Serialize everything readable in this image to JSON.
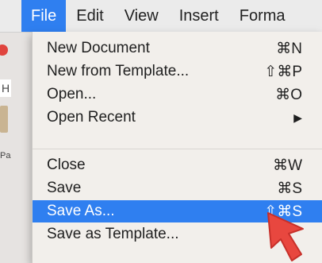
{
  "menubar": {
    "items": [
      {
        "label": "File"
      },
      {
        "label": "Edit"
      },
      {
        "label": "View"
      },
      {
        "label": "Insert"
      },
      {
        "label": "Forma"
      }
    ]
  },
  "background": {
    "h_label": "H",
    "pa_label": "Pa"
  },
  "file_menu": {
    "items": [
      {
        "label": "New Document",
        "shortcut": "⌘N"
      },
      {
        "label": "New from Template...",
        "shortcut": "⇧⌘P"
      },
      {
        "label": "Open...",
        "shortcut": "⌘O"
      },
      {
        "label": "Open Recent",
        "shortcut": "▶"
      },
      {
        "label": "Close",
        "shortcut": "⌘W"
      },
      {
        "label": "Save",
        "shortcut": "⌘S"
      },
      {
        "label": "Save As...",
        "shortcut": "⇧⌘S"
      },
      {
        "label": "Save as Template...",
        "shortcut": ""
      }
    ],
    "highlighted_item": "Save As..."
  },
  "colors": {
    "accent": "#2f7ff0",
    "pointer": "#e8473f"
  },
  "icons": [
    "pointer-arrow-icon",
    "submenu-arrow-icon"
  ]
}
